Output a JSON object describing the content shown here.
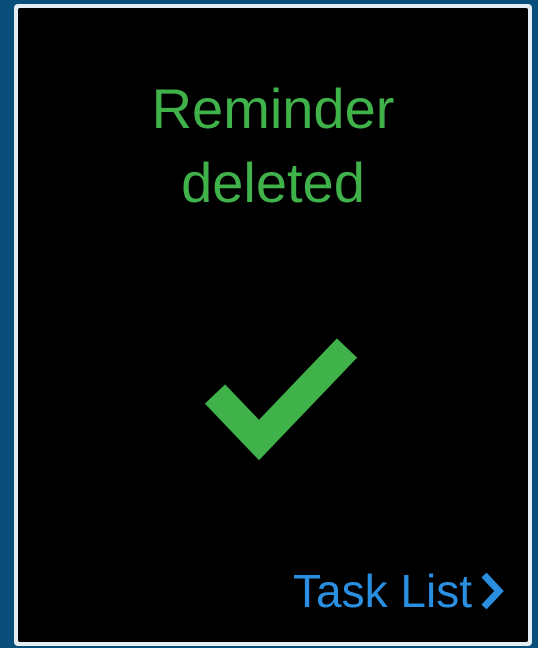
{
  "message": {
    "line1": "Reminder",
    "line2": "deleted"
  },
  "status_icon": "checkmark-icon",
  "navigation": {
    "label": "Task List",
    "icon": "chevron-right-icon"
  },
  "colors": {
    "background": "#0a4f7c",
    "screen": "#000000",
    "success_green": "#3fb24a",
    "link_blue": "#2a8fe0"
  }
}
